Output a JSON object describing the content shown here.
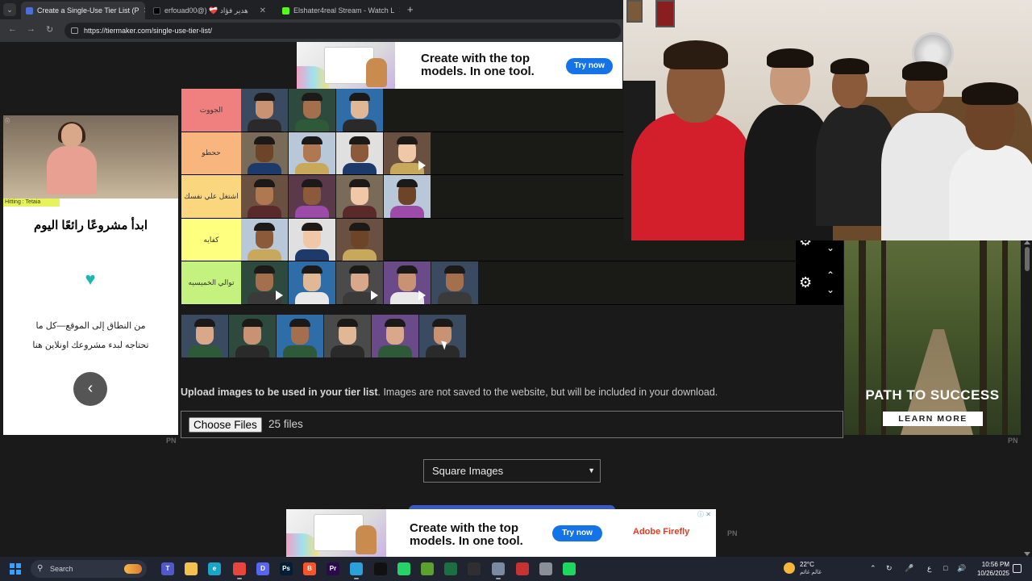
{
  "browser": {
    "tabs": [
      {
        "label": "Create a Single-Use Tier List (P",
        "active": true,
        "favicon_color": "#4a6fd8"
      },
      {
        "label": "erfouad00@) ❤️‍🩹 هدير فؤاد",
        "active": false,
        "favicon_color": "#000000"
      },
      {
        "label": "Elshater4real Stream - Watch L",
        "active": false,
        "favicon_color": "#53fc18"
      }
    ],
    "url": "https://tiermaker.com/single-use-tier-list/"
  },
  "ads": {
    "top": {
      "headline_line1": "Create with the top",
      "headline_line2": "models. In one tool.",
      "cta": "Try now"
    },
    "bottom": {
      "headline_line1": "Create with the top",
      "headline_line2": "models. In one tool.",
      "cta": "Try now",
      "brand": "Adobe Firefly"
    },
    "left": {
      "brand_tag": "Hitting : Tetaia",
      "headline": "ابدأ مشروعًا رائعًا اليوم",
      "body_line1": "من النطاق إلى الموقع—كل ما",
      "body_line2": "تحتاجه لبدء مشروعك اونلاين هنا",
      "back_icon": "chevron-left-icon"
    },
    "right": {
      "title": "PATH TO SUCCESS",
      "cta": "LEARN MORE"
    },
    "pn_label": "PN"
  },
  "tiers": [
    {
      "label": "الجووت",
      "color": "#f08080",
      "items": 3
    },
    {
      "label": "ححطو",
      "color": "#f8b67e",
      "items": 4
    },
    {
      "label": "اشتغل علي نفسك",
      "color": "#fad67f",
      "items": 4
    },
    {
      "label": "كفايه",
      "color": "#fefe7f",
      "items": 3
    },
    {
      "label": "توالي الخميسيه",
      "color": "#c5f27e",
      "items": 5
    }
  ],
  "pool_count": 6,
  "upload": {
    "text_bold": "Upload images to be used in your tier list",
    "text_rest": ". Images are not saved to the website, but will be included in your download.",
    "button": "Choose Files",
    "file_count": "25 files"
  },
  "image_shape_select": {
    "selected": "Square Images"
  },
  "taskbar": {
    "search_placeholder": "Search",
    "weather_temp": "22°C",
    "weather_cond": "غالم غائم",
    "lang": "ع",
    "time": "10:56 PM",
    "date": "10/26/2025"
  }
}
